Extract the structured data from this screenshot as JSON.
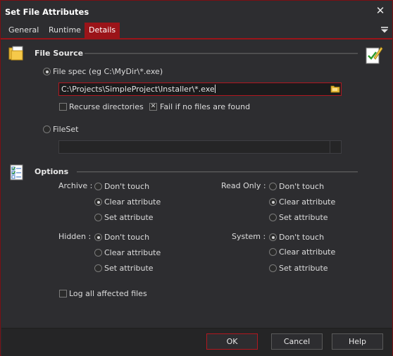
{
  "window": {
    "title": "Set File Attributes"
  },
  "tabs": [
    {
      "label": "General"
    },
    {
      "label": "Runtime"
    },
    {
      "label": "Details"
    }
  ],
  "file_source": {
    "title": "File Source",
    "file_spec": {
      "label": "File spec (eg C:\\MyDir\\*.exe)",
      "selected": true
    },
    "path_value": "C:\\Projects\\SimpleProject\\Installer\\*.exe",
    "recurse": {
      "label": "Recurse directories",
      "checked": false
    },
    "fail_if_none": {
      "label": "Fail if no files are found",
      "checked": true
    },
    "fileset": {
      "label": "FileSet",
      "selected": false
    },
    "fileset_value": ""
  },
  "options": {
    "title": "Options",
    "archive": {
      "label": "Archive :",
      "choices": [
        "Don't touch",
        "Clear attribute",
        "Set attribute"
      ],
      "selected": "Clear attribute"
    },
    "read_only": {
      "label": "Read Only :",
      "choices": [
        "Don't touch",
        "Clear attribute",
        "Set attribute"
      ],
      "selected": "Clear attribute"
    },
    "hidden": {
      "label": "Hidden :",
      "choices": [
        "Don't touch",
        "Clear attribute",
        "Set attribute"
      ],
      "selected": "Don't touch"
    },
    "system": {
      "label": "System :",
      "choices": [
        "Don't touch",
        "Clear attribute",
        "Set attribute"
      ],
      "selected": "Don't touch"
    },
    "log_all": {
      "label": "Log all affected files",
      "checked": false
    }
  },
  "buttons": {
    "ok": "OK",
    "cancel": "Cancel",
    "help": "Help"
  },
  "icons": {
    "close": "close-icon",
    "tab_menu": "menu-arrow-icon",
    "file_source": "files-icon",
    "validate": "edit-check-icon",
    "browse": "folder-icon",
    "options": "checklist-icon"
  },
  "colors": {
    "accent": "#9b1419",
    "background": "#2d2d30",
    "field": "#1b1b1c"
  }
}
